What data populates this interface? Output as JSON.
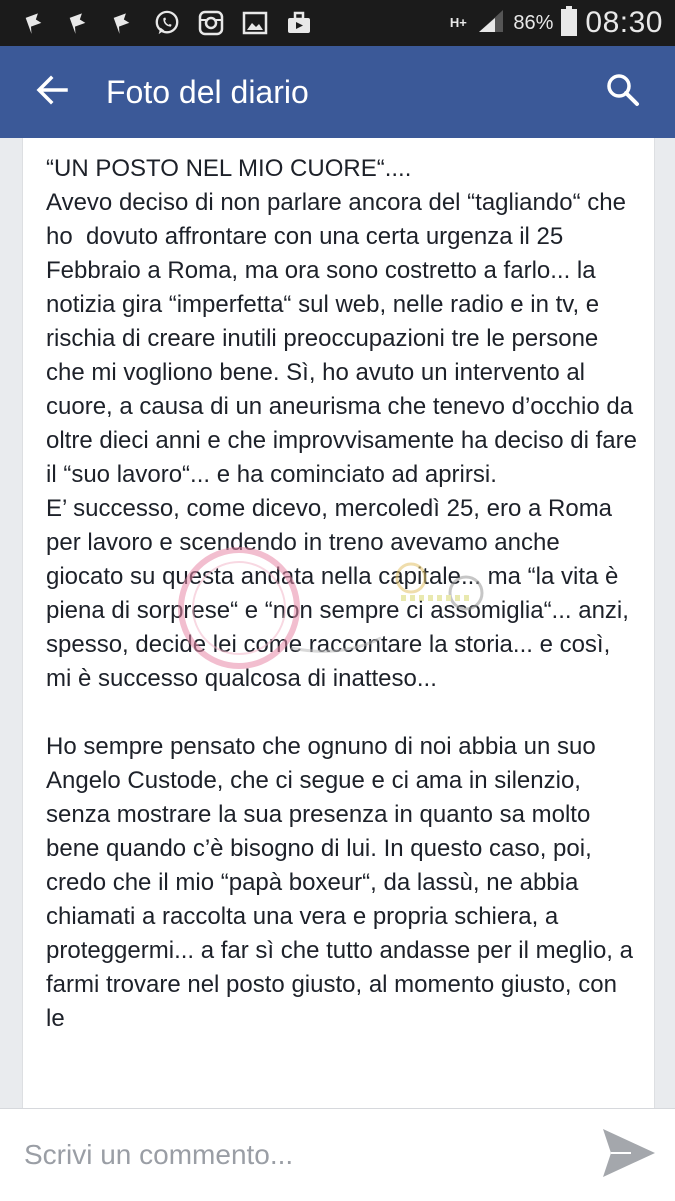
{
  "status_bar": {
    "network": "H+",
    "battery_percent": "86%",
    "time": "08:30",
    "icons": [
      "flag-icon",
      "flag-icon",
      "flag-icon",
      "whatsapp-icon",
      "instagram-icon",
      "gallery-icon",
      "briefcase-icon"
    ]
  },
  "app_bar": {
    "title": "Foto del diario",
    "back_icon": "arrow-left-icon",
    "search_icon": "search-icon",
    "color": "#3b5998"
  },
  "post": {
    "paragraphs": [
      "“UN POSTO NEL MIO CUORE“....\nAvevo deciso di non parlare ancora del “tagliando“ che ho  dovuto affrontare con una certa urgenza il 25 Febbraio a Roma, ma ora sono costretto a farlo... la notizia gira “imperfetta“ sul web, nelle radio e in tv, e rischia di creare inutili preoccupazioni tre le persone che mi vogliono bene. Sì, ho avuto un intervento al cuore, a causa di un aneurisma che tenevo d’occhio da oltre dieci anni e che improvvisamente ha deciso di fare il “suo lavoro“... e ha cominciato ad aprirsi.\nE’ successo, come dicevo, mercoledì 25, ero a Roma per lavoro e scendendo in treno avevamo anche giocato su questa andata nella capitale... ma “la vita è piena di sorprese“ e “non sempre ci assomiglia“... anzi, spesso, decide lei come raccontare la storia... e così, mi è successo qualcosa di inatteso...",
      "Ho sempre pensato che ognuno di noi abbia un suo Angelo Custode, che ci segue e ci ama in silenzio, senza mostrare la sua presenza in quanto sa molto bene quando c’è bisogno di lui. In questo caso, poi, credo che il mio “papà boxeur“, da lassù, ne abbia chiamati a raccolta una vera e propria schiera, a proteggermi... a far sì che tutto andasse per il meglio, a farmi trovare nel posto giusto, al momento giusto, con le"
    ]
  },
  "comment_bar": {
    "placeholder": "Scrivi un commento...",
    "send_icon": "send-icon"
  }
}
